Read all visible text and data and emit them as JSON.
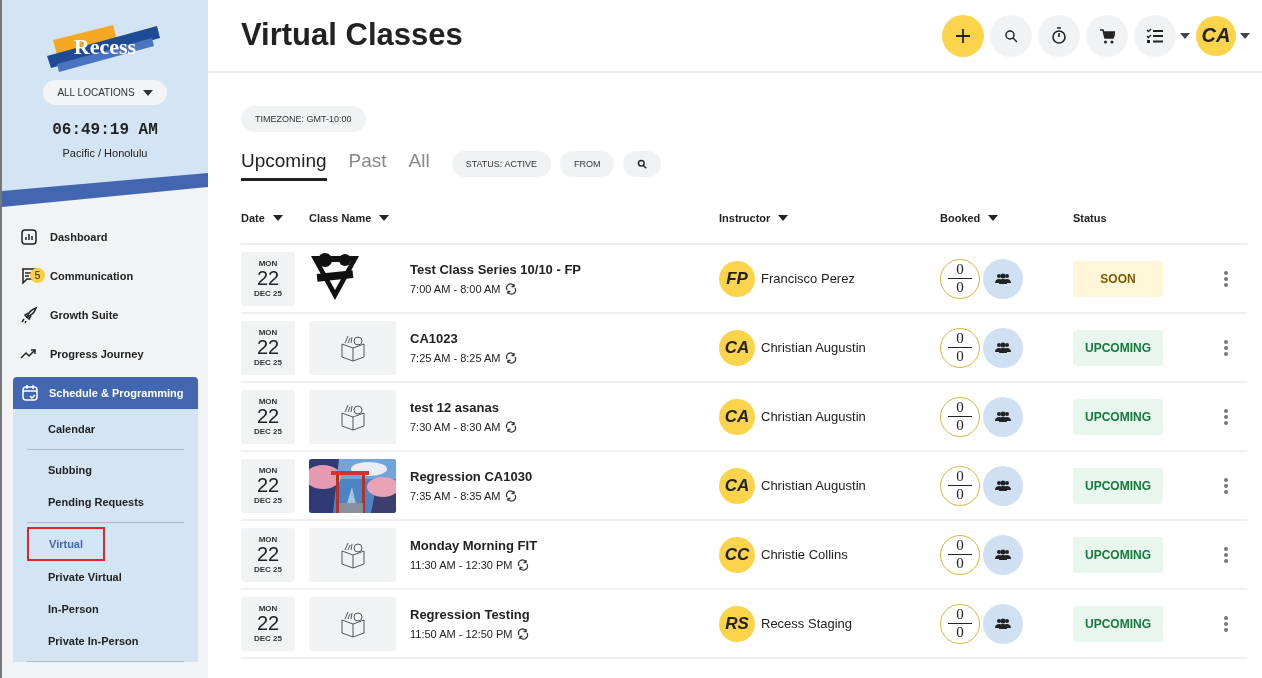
{
  "sidebar": {
    "logo": "Recess",
    "location_button": "ALL LOCATIONS",
    "clock": "06:49:19 AM",
    "timezone": "Pacific / Honolulu",
    "nav": [
      {
        "label": "Dashboard"
      },
      {
        "label": "Communication",
        "badge": "5"
      },
      {
        "label": "Growth Suite"
      },
      {
        "label": "Progress Journey"
      },
      {
        "label": "Schedule & Programming",
        "expanded": true,
        "children": [
          [
            {
              "label": "Calendar",
              "selected": false
            }
          ],
          [
            {
              "label": "Subbing",
              "selected": false
            },
            {
              "label": "Pending Requests",
              "selected": false
            }
          ],
          [
            {
              "label": "Virtual",
              "selected": true
            },
            {
              "label": "Private Virtual",
              "selected": false
            },
            {
              "label": "In-Person",
              "selected": false
            },
            {
              "label": "Private In-Person",
              "selected": false
            }
          ]
        ]
      }
    ]
  },
  "header": {
    "title": "Virtual Classes",
    "avatar": "CA"
  },
  "filters": {
    "timezone": "TIMEZONE: GMT-10:00",
    "tabs": [
      {
        "label": "Upcoming",
        "selected": true
      },
      {
        "label": "Past",
        "selected": false
      },
      {
        "label": "All",
        "selected": false
      }
    ],
    "chips": [
      "STATUS: ACTIVE",
      "FROM"
    ]
  },
  "table": {
    "columns": [
      {
        "label": "Date",
        "sortable": true
      },
      {
        "label": "Class Name",
        "sortable": true
      },
      {
        "label": "Instructor",
        "sortable": true
      },
      {
        "label": "Booked",
        "sortable": true
      },
      {
        "label": "Status",
        "sortable": false
      }
    ],
    "rows": [
      {
        "day": "MON",
        "date": "22",
        "month": "DEC 25",
        "thumbnail": {
          "kind": "logo"
        },
        "name": "Test Class Series 10/10 - FP",
        "time": "7:00 AM - 8:00 AM",
        "recurring": true,
        "initials": "FP",
        "instructor": "Francisco Perez",
        "booked": "0",
        "capacity": "0",
        "status": {
          "label": "SOON",
          "kind": "soon"
        }
      },
      {
        "day": "MON",
        "date": "22",
        "month": "DEC 25",
        "thumbnail": {
          "kind": "placeholder"
        },
        "name": "CA1023",
        "time": "7:25 AM - 8:25 AM",
        "recurring": true,
        "initials": "CA",
        "instructor": "Christian Augustin",
        "booked": "0",
        "capacity": "0",
        "status": {
          "label": "UPCOMING",
          "kind": "upcoming"
        }
      },
      {
        "day": "MON",
        "date": "22",
        "month": "DEC 25",
        "thumbnail": {
          "kind": "placeholder"
        },
        "name": "test 12 asanas",
        "time": "7:30 AM - 8:30 AM",
        "recurring": true,
        "initials": "CA",
        "instructor": "Christian Augustin",
        "booked": "0",
        "capacity": "0",
        "status": {
          "label": "UPCOMING",
          "kind": "upcoming"
        }
      },
      {
        "day": "MON",
        "date": "22",
        "month": "DEC 25",
        "name": "Regression CA1030",
        "time": "7:35 AM - 8:35 AM",
        "recurring": true,
        "initials": "CA",
        "instructor": "Christian Augustin",
        "booked": "0",
        "capacity": "0",
        "status": {
          "label": "UPCOMING",
          "kind": "upcoming"
        }
      },
      {
        "day": "MON",
        "date": "22",
        "month": "DEC 25",
        "thumbnail": {
          "kind": "placeholder"
        },
        "name": "Monday Morning FIT",
        "time": "11:30 AM - 12:30 PM",
        "recurring": true,
        "initials": "CC",
        "instructor": "Christie Collins",
        "booked": "0",
        "capacity": "0",
        "status": {
          "label": "UPCOMING",
          "kind": "upcoming"
        }
      },
      {
        "day": "MON",
        "date": "22",
        "month": "DEC 25",
        "thumbnail": {
          "kind": "placeholder"
        },
        "name": "Regression Testing",
        "time": "11:50 AM - 12:50 PM",
        "recurring": true,
        "initials": "RS",
        "instructor": "Recess Staging",
        "booked": "0",
        "capacity": "0",
        "status": {
          "label": "UPCOMING",
          "kind": "upcoming"
        }
      }
    ]
  }
}
